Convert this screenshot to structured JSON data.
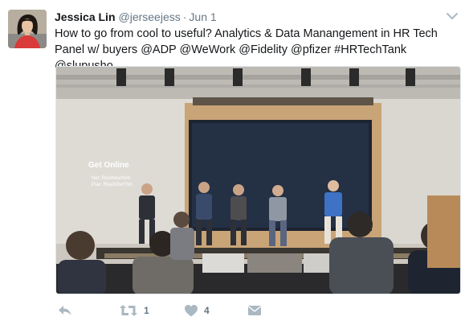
{
  "tweet": {
    "author_name": "Jessica Lin",
    "author_handle": "@jerseejess",
    "separator": "·",
    "date": "Jun 1",
    "text_line1": "How to go from cool to useful? Analytics & Data Manangement in HR Tech",
    "text_line2": "Panel w/ buyers @ADP @WeWork @Fidelity @pfizer #HRTechTank @slupusho"
  },
  "photo": {
    "wall_text_title": "Get Online",
    "wall_text_net": "Net: RiseNewYork",
    "wall_text_psw": "Psw: RiseN3wY0rk"
  },
  "actions": {
    "reply_icon": "reply-icon",
    "retweet_icon": "retweet-icon",
    "retweet_count": "1",
    "like_icon": "heart-icon",
    "like_count": "4",
    "dm_icon": "envelope-icon"
  },
  "colors": {
    "icon_gray": "#aab8c2",
    "meta_gray": "#657786",
    "text_dark": "#14171a"
  }
}
